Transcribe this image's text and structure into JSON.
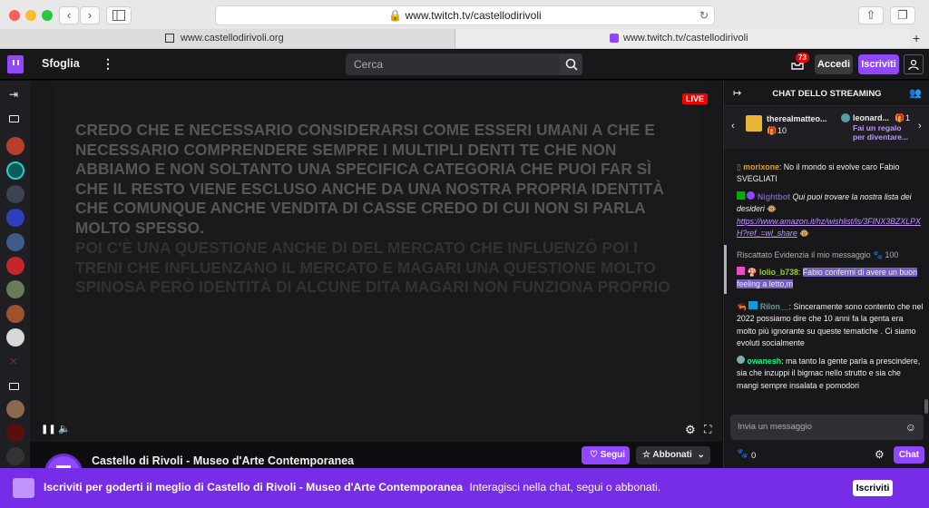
{
  "browser": {
    "url": "www.twitch.tv/castellodirivoli",
    "tabs": [
      {
        "label": "www.castellodirivoli.org"
      },
      {
        "label": "www.twitch.tv/castellodirivoli"
      }
    ]
  },
  "topnav": {
    "browse_label": "Sfoglia",
    "search_placeholder": "Cerca",
    "notification_count": "73",
    "login_label": "Accedi",
    "signup_label": "Iscriviti"
  },
  "video": {
    "caption_primary": "Credo che e necessario considerarsi come esseri umani a che e necessario comprendere sempre i multipli denti te che non abbiamo e non soltanto una specifica categoria che puoi far sì che il resto viene escluso anche da una nostra propria identità che comunque anche vendita di casse credo di cui non si parla molto spesso.",
    "caption_secondary": "Poi c'è una questione anche di del mercato che influenzò poi i treni che influenzano il mercato e magari una questione molto spinosa però identità di alcune dita magari non funziona proprio",
    "live_label": "LIVE"
  },
  "channel": {
    "name": "Castello di Rivoli - Museo d'Arte Contemporanea",
    "follow_label": "Segui",
    "subscribe_label": "Abbonati"
  },
  "chat": {
    "header": "CHAT DELLO STREAMING",
    "gifters": [
      {
        "name": "therealmatteo...",
        "count": "10"
      },
      {
        "name": "leonard...",
        "count": "1",
        "text": "Fai un regalo per diventare..."
      }
    ],
    "messages": [
      {
        "user": "morixone",
        "text": "No il mondo si evolve caro Fabio SVEGLIATI",
        "color": "#daa520"
      },
      {
        "user": "Nightbot",
        "text": "Qui puoi trovare la nostra lista dei desideri",
        "link": "https://www.amazon.it/hz/wishlist/ls/3FINX3BZXLPXH?ref_=wl_share",
        "color": "#7d5bbe"
      },
      {
        "redeemed_label": "Riscattato Evidenzia il mio messaggio",
        "points": "100"
      },
      {
        "user": "lolio_b738",
        "text": "Fabio confermi di avere un buon feeling a letto,m",
        "color": "#9acd32"
      },
      {
        "user": "Rilon__",
        "text": "Sinceramente sono contento che nel 2022 possiamo dire che 10 anni fa la genta era molto più ignorante su queste tematiche . Ci siamo evoluti socialmente",
        "color": "#5f9ea0"
      },
      {
        "user": "owanesh",
        "text": "ma tanto la gente parla a prescindere, sia che inzuppi il bigmac nello strutto e sia che mangi sempre insalata e pomodori",
        "color": "#00ff7f"
      }
    ],
    "input_placeholder": "Invia un messaggio",
    "points_value": "0",
    "send_label": "Chat"
  },
  "banner": {
    "main_text": "Iscriviti per goderti il meglio di Castello di Rivoli - Museo d'Arte Contemporanea",
    "sub_text": "Interagisci nella chat, segui o abbonati.",
    "button_label": "Iscriviti"
  },
  "colors": {
    "twitch_purple": "#9147ff",
    "banner_purple": "#772ce8",
    "live_red": "#eb0400"
  }
}
